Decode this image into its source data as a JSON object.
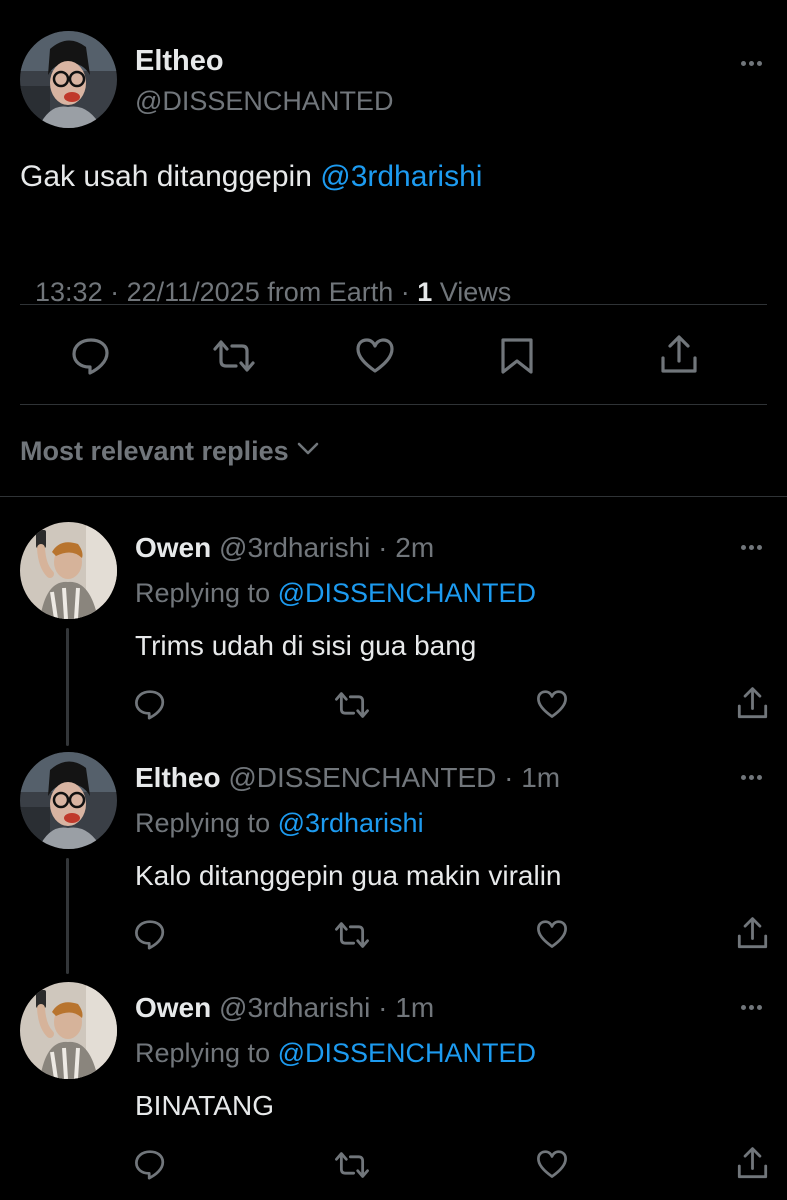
{
  "main_tweet": {
    "author_name": "Eltheo",
    "author_handle": "@DISSENCHANTED",
    "text_prefix": "Gak usah ditanggepin ",
    "mention": "@3rdharishi",
    "timestamp": "13:32 · 22/11/2025 from Earth · ",
    "views_count": "1",
    "views_label": " Views"
  },
  "replies_header": {
    "label": "Most relevant replies"
  },
  "replies": [
    {
      "name": "Owen",
      "handle": "@3rdharishi · 2m",
      "replying_prefix": "Replying to ",
      "replying_to": "@DISSENCHANTED",
      "text": "Trims udah di sisi gua bang",
      "avatar": "owen"
    },
    {
      "name": "Eltheo",
      "handle": "@DISSENCHANTED · 1m",
      "replying_prefix": "Replying to ",
      "replying_to": "@3rdharishi",
      "text": "Kalo ditanggepin gua makin viralin",
      "avatar": "eltheo"
    },
    {
      "name": "Owen",
      "handle": "@3rdharishi · 1m",
      "replying_prefix": "Replying to ",
      "replying_to": "@DISSENCHANTED",
      "text": "BINATANG",
      "avatar": "owen"
    }
  ],
  "icons": {
    "reply": "speech-bubble-icon",
    "retweet": "retweet-arrows-icon",
    "like": "heart-icon",
    "bookmark": "bookmark-icon",
    "share": "share-upload-icon",
    "more": "more-dots-icon",
    "chevron": "chevron-down-icon"
  },
  "colors": {
    "background": "#000000",
    "text": "#e7e9ea",
    "muted": "#71767b",
    "link": "#1d9bf0",
    "divider": "#2f3336"
  }
}
